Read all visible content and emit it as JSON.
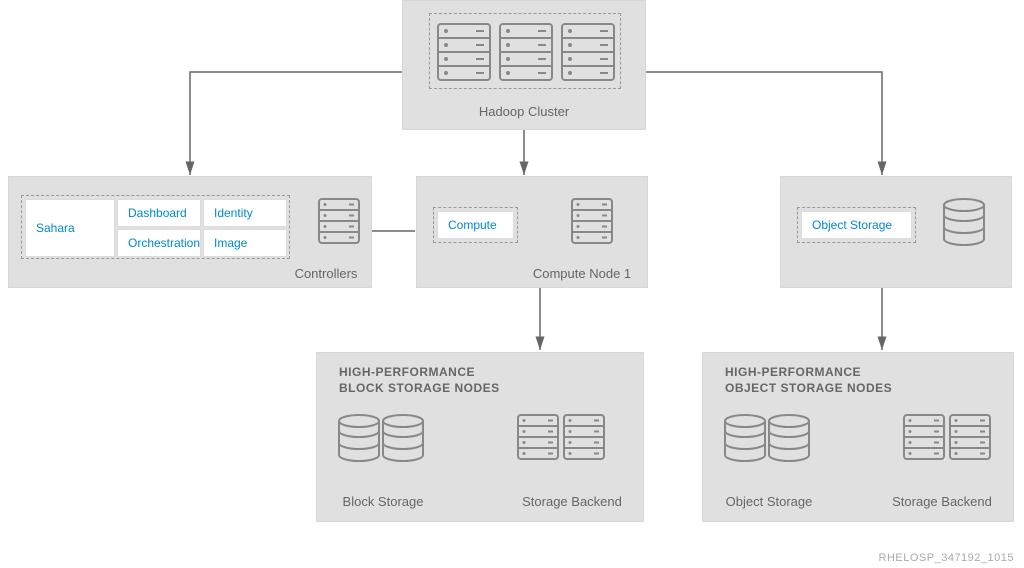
{
  "top": {
    "hadoop_cluster": "Hadoop Cluster"
  },
  "mid": {
    "controllers": {
      "services": {
        "dashboard": "Dashboard",
        "identity": "Identity",
        "orchestration": "Orchestration",
        "image": "Image",
        "sahara": "Sahara"
      },
      "label": "Controllers"
    },
    "compute": {
      "service": "Compute",
      "label": "Compute Node 1"
    },
    "object": {
      "service": "Object Storage"
    }
  },
  "bottom": {
    "block_storage": {
      "title_line1": "HIGH-PERFORMANCE",
      "title_line2": "BLOCK STORAGE NODES",
      "left_label": "Block Storage",
      "right_label": "Storage Backend"
    },
    "object_storage": {
      "title_line1": "HIGH-PERFORMANCE",
      "title_line2": "OBJECT STORAGE NODES",
      "left_label": "Object Storage",
      "right_label": "Storage Backend"
    }
  },
  "footer_id": "RHELOSP_347192_1015"
}
